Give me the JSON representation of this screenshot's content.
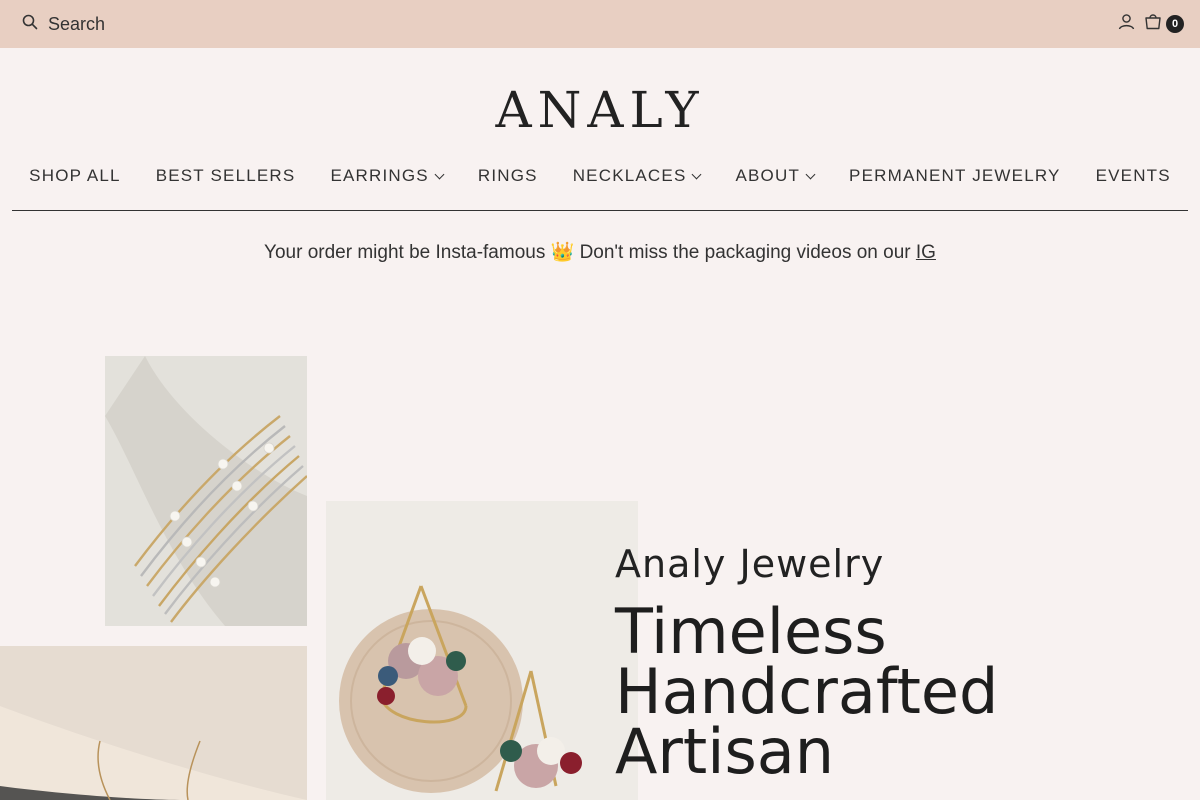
{
  "topbar": {
    "search_label": "Search",
    "cart_count": "0",
    "icons": [
      "search-icon",
      "account-icon",
      "cart-icon"
    ],
    "background": "#e8cfc2"
  },
  "brand": {
    "logo_text": "ANALY"
  },
  "nav": {
    "items": [
      {
        "label": "SHOP ALL",
        "has_dropdown": false
      },
      {
        "label": "BEST SELLERS",
        "has_dropdown": false
      },
      {
        "label": "EARRINGS",
        "has_dropdown": true
      },
      {
        "label": "RINGS",
        "has_dropdown": false
      },
      {
        "label": "NECKLACES",
        "has_dropdown": true
      },
      {
        "label": "ABOUT",
        "has_dropdown": true
      },
      {
        "label": "PERMANENT JEWELRY",
        "has_dropdown": false
      },
      {
        "label": "EVENTS",
        "has_dropdown": false
      }
    ]
  },
  "announcement": {
    "text_before": "Your order might be Insta-famous",
    "emoji": "👑",
    "text_after": "Don't miss the packaging videos on our",
    "link_label": "IG"
  },
  "hero": {
    "subtitle": "Analy Jewelry",
    "title_lines": [
      "Timeless",
      "Handcrafted",
      "Artisan"
    ]
  },
  "colors": {
    "page_background": "#f8f2f1",
    "text": "#2b2b2b",
    "badge": "#222222"
  }
}
